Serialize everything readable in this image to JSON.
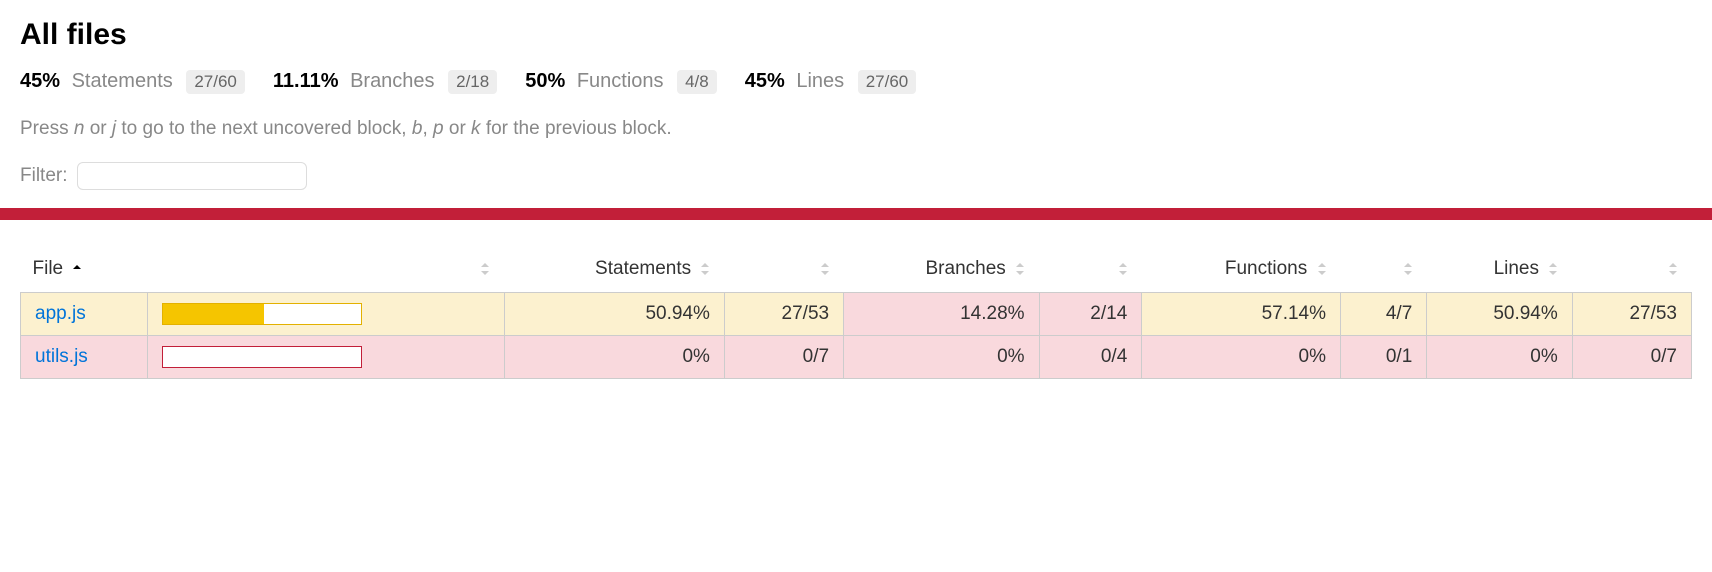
{
  "title": "All files",
  "summary": [
    {
      "pct": "45%",
      "label": "Statements",
      "badge": "27/60"
    },
    {
      "pct": "11.11%",
      "label": "Branches",
      "badge": "2/18"
    },
    {
      "pct": "50%",
      "label": "Functions",
      "badge": "4/8"
    },
    {
      "pct": "45%",
      "label": "Lines",
      "badge": "27/60"
    }
  ],
  "hint": {
    "pre": "Press ",
    "k1": "n",
    "mid1": " or ",
    "k2": "j",
    "mid2": " to go to the next uncovered block, ",
    "k3": "b",
    "mid3": ", ",
    "k4": "p",
    "mid4": " or ",
    "k5": "k",
    "post": " for the previous block."
  },
  "filter": {
    "label": "Filter:",
    "value": ""
  },
  "columns": {
    "file": "File",
    "bar": "",
    "stmt_pct": "Statements",
    "stmt_ratio": "",
    "branch_pct": "Branches",
    "branch_ratio": "",
    "func_pct": "Functions",
    "func_ratio": "",
    "line_pct": "Lines",
    "line_ratio": ""
  },
  "rows": [
    {
      "file": "app.js",
      "status": "yellow",
      "bar_pct": 50.94,
      "stmt_pct": "50.94%",
      "stmt_ratio": "27/53",
      "branch_pct": "14.28%",
      "branch_status": "red",
      "branch_ratio": "2/14",
      "func_pct": "57.14%",
      "func_ratio": "4/7",
      "line_pct": "50.94%",
      "line_ratio": "27/53"
    },
    {
      "file": "utils.js",
      "status": "red",
      "bar_pct": 0,
      "stmt_pct": "0%",
      "stmt_ratio": "0/7",
      "branch_pct": "0%",
      "branch_status": "red",
      "branch_ratio": "0/4",
      "func_pct": "0%",
      "func_ratio": "0/1",
      "line_pct": "0%",
      "line_ratio": "0/7"
    }
  ]
}
